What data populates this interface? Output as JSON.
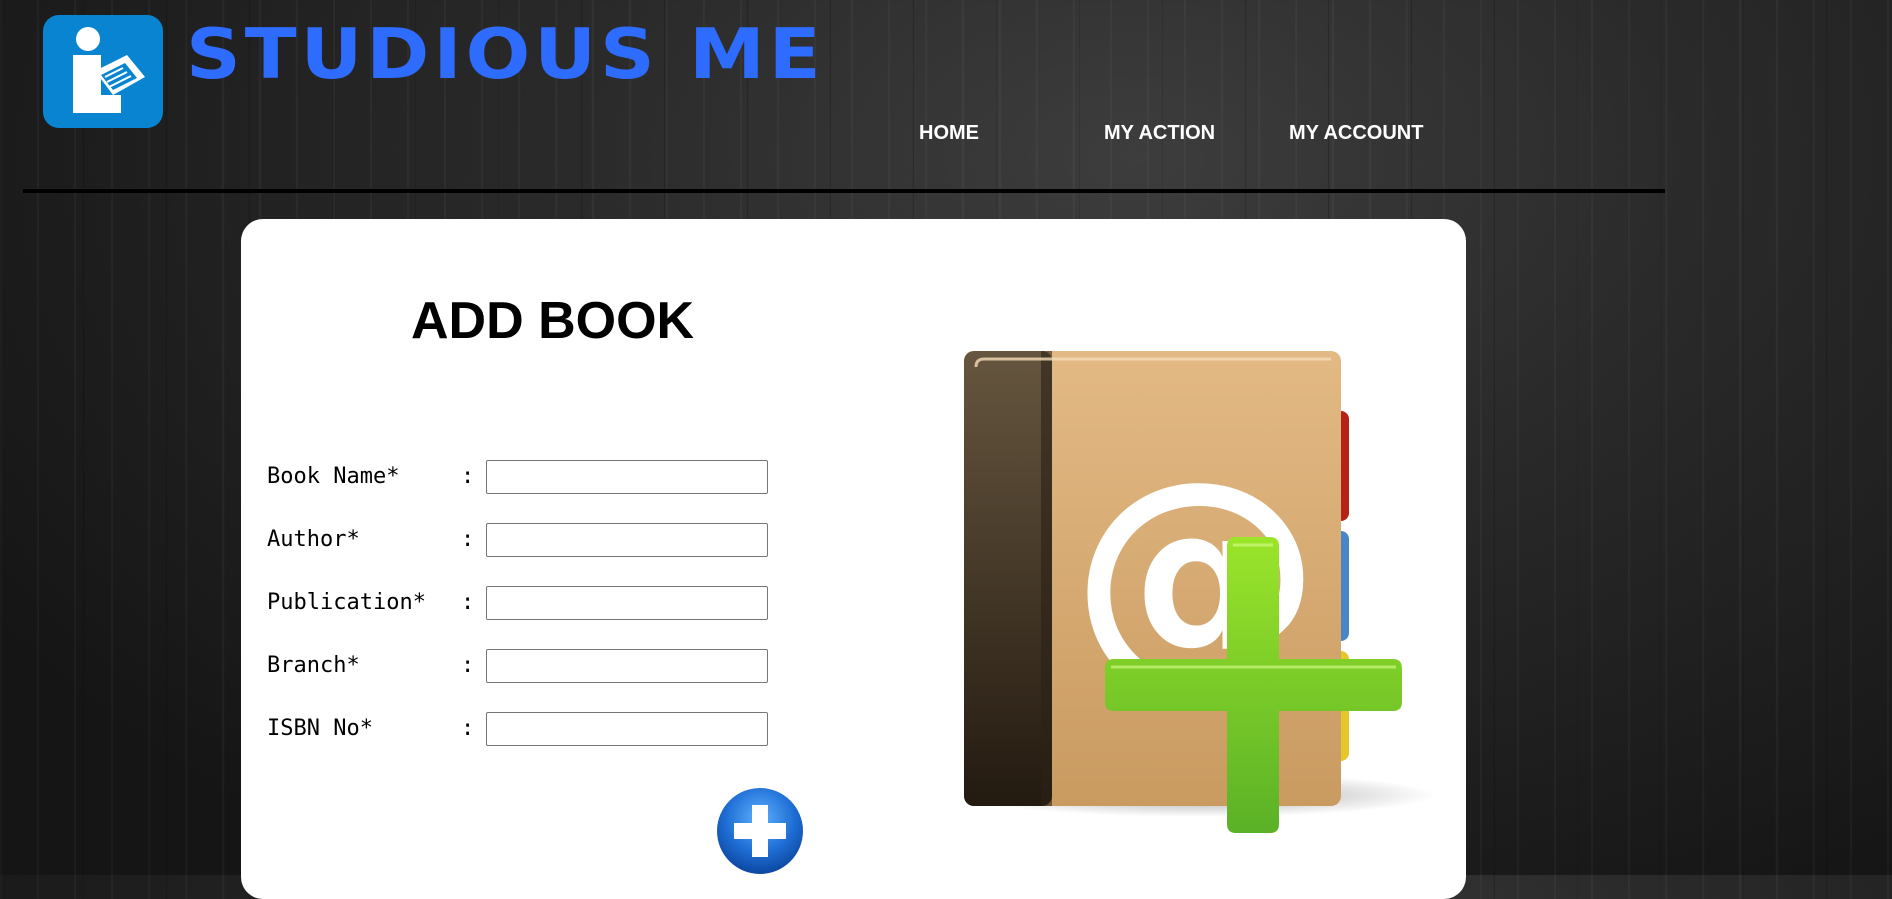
{
  "header": {
    "site_title": "STUDIOUS ME",
    "logo_icon": "library-reader-icon",
    "brand_color": "#2e6bff",
    "logo_bg_color": "#0884d1"
  },
  "nav": {
    "items": [
      {
        "label": "HOME"
      },
      {
        "label": "MY ACTION"
      },
      {
        "label": "MY ACCOUNT"
      }
    ]
  },
  "form": {
    "title": "ADD BOOK",
    "fields": [
      {
        "label": "Book Name*",
        "separator": ":",
        "value": "",
        "placeholder": ""
      },
      {
        "label": "Author*",
        "separator": ":",
        "value": "",
        "placeholder": ""
      },
      {
        "label": "Publication*",
        "separator": ":",
        "value": "",
        "placeholder": ""
      },
      {
        "label": "Branch*",
        "separator": ":",
        "value": "",
        "placeholder": ""
      },
      {
        "label": "ISBN No*",
        "separator": ":",
        "value": "",
        "placeholder": ""
      }
    ],
    "submit_icon": "plus-circle-icon"
  },
  "illustration": {
    "icon": "address-book-add-icon",
    "colors": {
      "cover": "#d7ad76",
      "spine": "#3f3322",
      "plus": "#7ccb1f",
      "tab_red": "#b72216",
      "tab_blue": "#4a86c5",
      "tab_yellow": "#e6c72b"
    }
  }
}
